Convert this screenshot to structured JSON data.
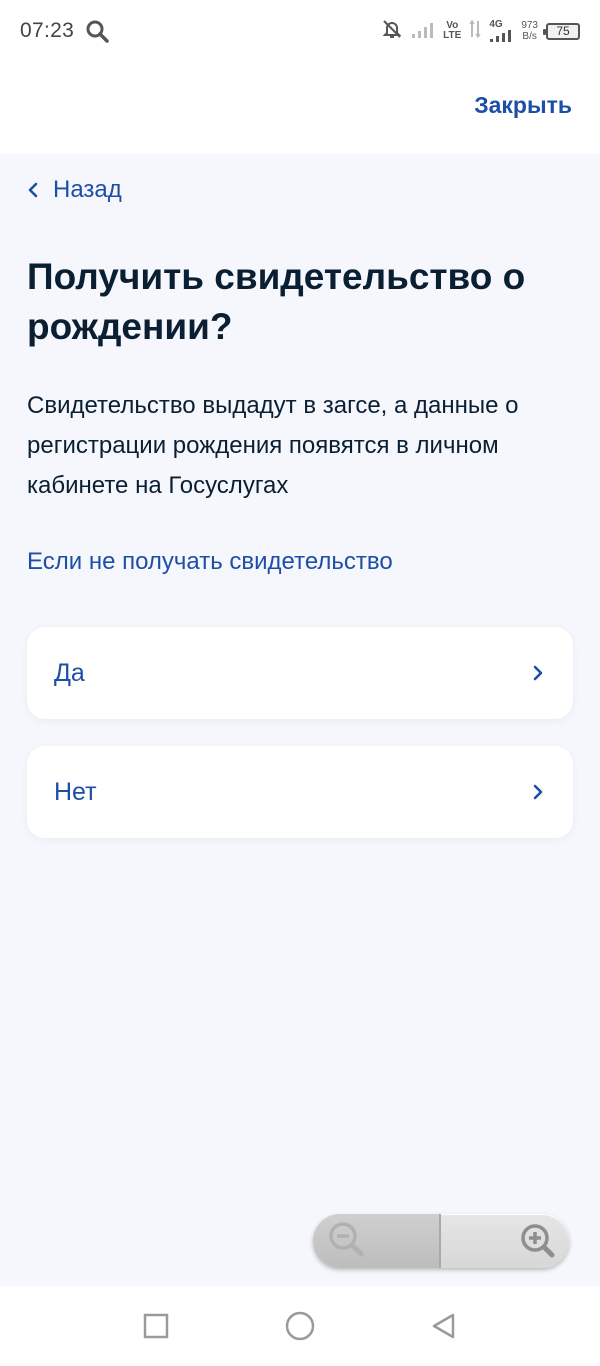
{
  "status_bar": {
    "time": "07:23",
    "volte_top": "Vo",
    "volte_bottom": "LTE",
    "network_type": "4G",
    "net_speed_value": "973",
    "net_speed_unit": "B/s",
    "battery_level": "75",
    "icons": [
      "search-icon",
      "bell-off-icon",
      "signal-icon",
      "data-arrows-icon",
      "signal-4g-icon",
      "battery-icon"
    ]
  },
  "header": {
    "close_label": "Закрыть"
  },
  "nav": {
    "back_label": "Назад"
  },
  "main": {
    "title": "Получить свидетельство о рождении?",
    "description": "Свидетельство выдадут в загсе, а данные о регистрации рождения появятся в личном кабинете на Госуслугах",
    "info_link": "Если не получать свидетельство",
    "options": [
      {
        "label": "Да"
      },
      {
        "label": "Нет"
      }
    ]
  },
  "zoom": {
    "icons": [
      "zoom-out-icon",
      "zoom-in-icon"
    ]
  },
  "system_nav": {
    "icons": [
      "recent-apps-icon",
      "home-icon",
      "back-icon"
    ]
  },
  "colors": {
    "accent": "#1d4fa6",
    "title": "#0b1f33",
    "background": "#f5f7fc",
    "card": "#ffffff"
  }
}
